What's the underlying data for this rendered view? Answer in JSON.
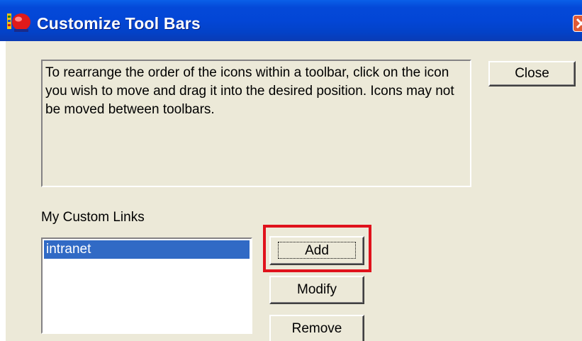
{
  "window": {
    "title": "Customize Tool Bars",
    "app_icon": "toolbar-app-icon",
    "close_icon": "close-icon"
  },
  "info": {
    "text": "To rearrange the order of the icons within a toolbar, click on the icon you wish to move and drag it into the desired position. Icons may not be moved between toolbars."
  },
  "buttons": {
    "close_label": "Close",
    "add_label": "Add",
    "modify_label": "Modify",
    "remove_label": "Remove"
  },
  "custom_links": {
    "label": "My Custom Links",
    "items": [
      {
        "label": "intranet",
        "selected": true
      }
    ]
  },
  "colors": {
    "title_bar": "#0346d6",
    "dialog_bg": "#ece9d8",
    "selection": "#316ac5",
    "highlight_annotation": "#e0121c",
    "close_button": "#e05a36"
  }
}
